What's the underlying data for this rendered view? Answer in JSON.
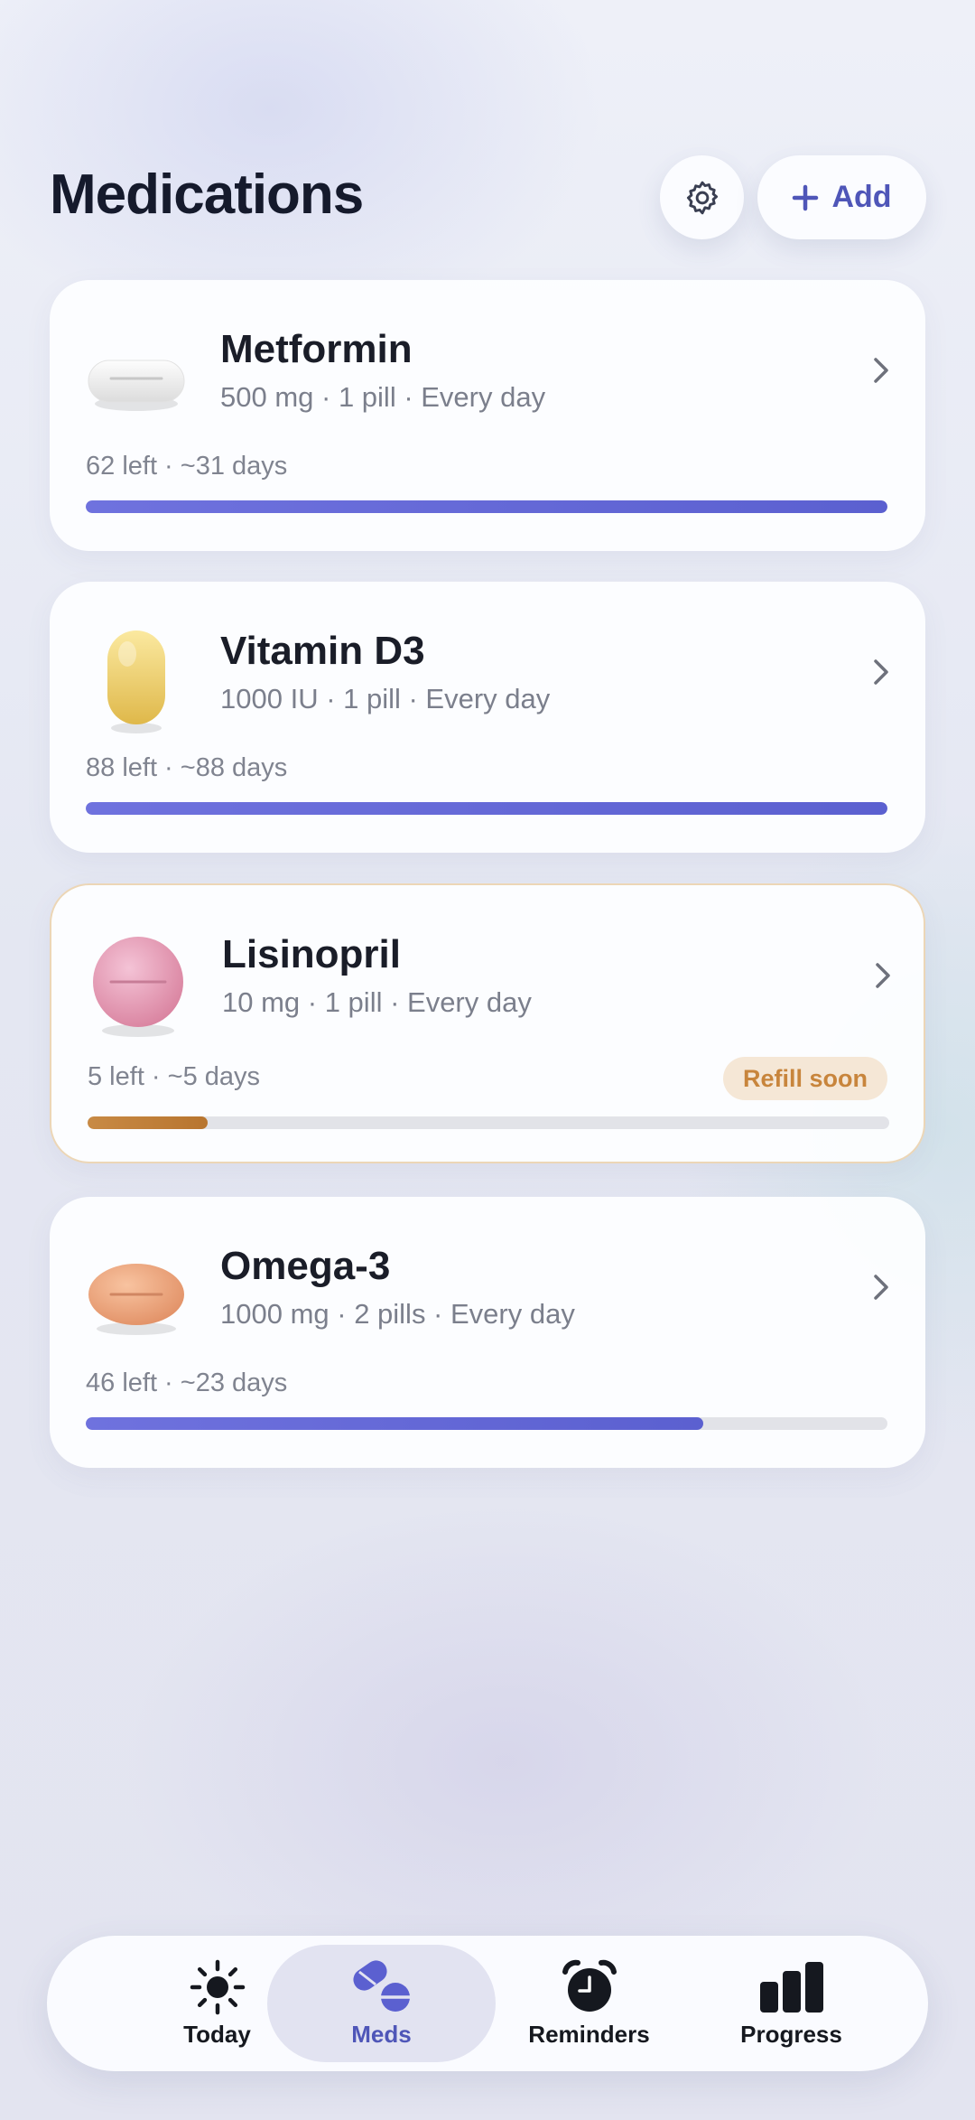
{
  "header": {
    "title": "Medications",
    "settings_icon": "gear-icon",
    "add_label": "Add"
  },
  "medications": [
    {
      "name": "Metformin",
      "dose": "500 mg · 1 pill · Every day",
      "supply": "62 left · ~31 days",
      "progress_percent": 100,
      "pill_icon": "white-oval-tablet-icon",
      "status": "ok"
    },
    {
      "name": "Vitamin D3",
      "dose": "1000 IU · 1 pill · Every day",
      "supply": "88 left · ~88 days",
      "progress_percent": 100,
      "pill_icon": "yellow-capsule-icon",
      "status": "ok"
    },
    {
      "name": "Lisinopril",
      "dose": "10 mg · 1 pill · Every day",
      "supply": "5 left · ~5 days",
      "progress_percent": 15,
      "pill_icon": "pink-round-tablet-icon",
      "status": "refill",
      "badge": "Refill soon"
    },
    {
      "name": "Omega-3",
      "dose": "1000 mg · 2 pills · Every day",
      "supply": "46 left · ~23 days",
      "progress_percent": 77,
      "pill_icon": "orange-oval-tablet-icon",
      "status": "ok"
    }
  ],
  "nav": {
    "tabs": [
      {
        "label": "Today",
        "icon": "sun-icon"
      },
      {
        "label": "Meds",
        "icon": "pills-icon",
        "active": true
      },
      {
        "label": "Reminders",
        "icon": "alarm-clock-icon"
      },
      {
        "label": "Progress",
        "icon": "bar-chart-icon"
      }
    ]
  },
  "colors": {
    "accent": "#5b60d0",
    "warning": "#c8853c",
    "warning_bg": "#f5e7d6",
    "title": "#151a2c"
  }
}
